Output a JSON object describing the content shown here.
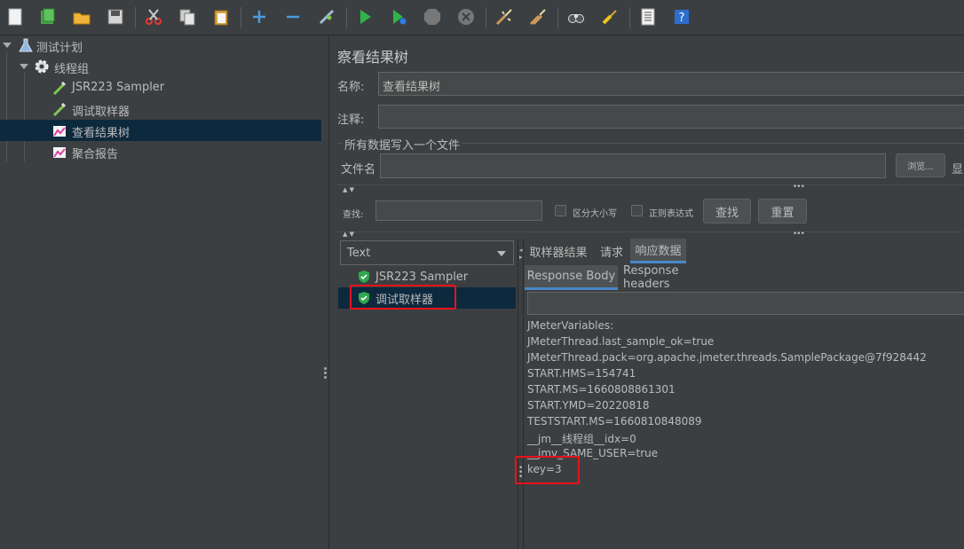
{
  "toolbar": {
    "icons": [
      "new-icon",
      "templates-icon",
      "open-icon",
      "save-icon",
      "cut-icon",
      "copy-icon",
      "paste-icon",
      "expand-icon",
      "collapse-icon",
      "toggle-icon",
      "start-icon",
      "start-no-pause-icon",
      "stop-icon",
      "shutdown-icon",
      "clear-icon",
      "clear-all-icon",
      "search-icon",
      "reset-search-icon",
      "function-helper-icon",
      "help-icon"
    ]
  },
  "tree": {
    "items": [
      {
        "label": "测试计划",
        "icon": "test-plan-icon"
      },
      {
        "label": "线程组",
        "icon": "thread-group-gear-icon"
      },
      {
        "label": "JSR223 Sampler",
        "icon": "sampler-pipette-icon"
      },
      {
        "label": "调试取样器",
        "icon": "sampler-pipette-icon"
      },
      {
        "label": "查看结果树",
        "icon": "listener-chart-icon"
      },
      {
        "label": "聚合报告",
        "icon": "listener-chart-icon"
      }
    ]
  },
  "panel": {
    "title": "察看结果树",
    "name_label": "名称:",
    "name_value": "查看结果树",
    "comment_label": "注释:",
    "comment_value": "",
    "write_all_label": "所有数据写入一个文件",
    "filename_label": "文件名",
    "filename_value": "",
    "browse_label": "浏览...",
    "display_label": "显",
    "search_label": "查找:",
    "search_value": "",
    "case_label": "区分大小写",
    "regex_label": "正则表达式",
    "find_button": "查找",
    "reset_button": "重置"
  },
  "results": {
    "renderer": "Text",
    "items": [
      {
        "label": "JSR223 Sampler",
        "status": "success"
      },
      {
        "label": "调试取样器",
        "status": "success"
      }
    ]
  },
  "tabs": {
    "main": [
      "取样器结果",
      "请求",
      "响应数据"
    ],
    "sub": [
      "Response Body",
      "Response headers"
    ]
  },
  "response": {
    "search_value": "",
    "lines": [
      "JMeterVariables:",
      "JMeterThread.last_sample_ok=true",
      "JMeterThread.pack=org.apache.jmeter.threads.SamplePackage@7f928442",
      "START.HMS=154741",
      "START.MS=1660808861301",
      "START.YMD=20220818",
      "TESTSTART.MS=1660810848089",
      "__jm__线程组__idx=0",
      "__jmv_SAME_USER=true",
      "key=3"
    ]
  },
  "colors": {
    "background": "#3c3f41",
    "selection": "#0d293e",
    "highlight_box": "#e8121b",
    "active_tab_underline": "#4a88c7"
  }
}
